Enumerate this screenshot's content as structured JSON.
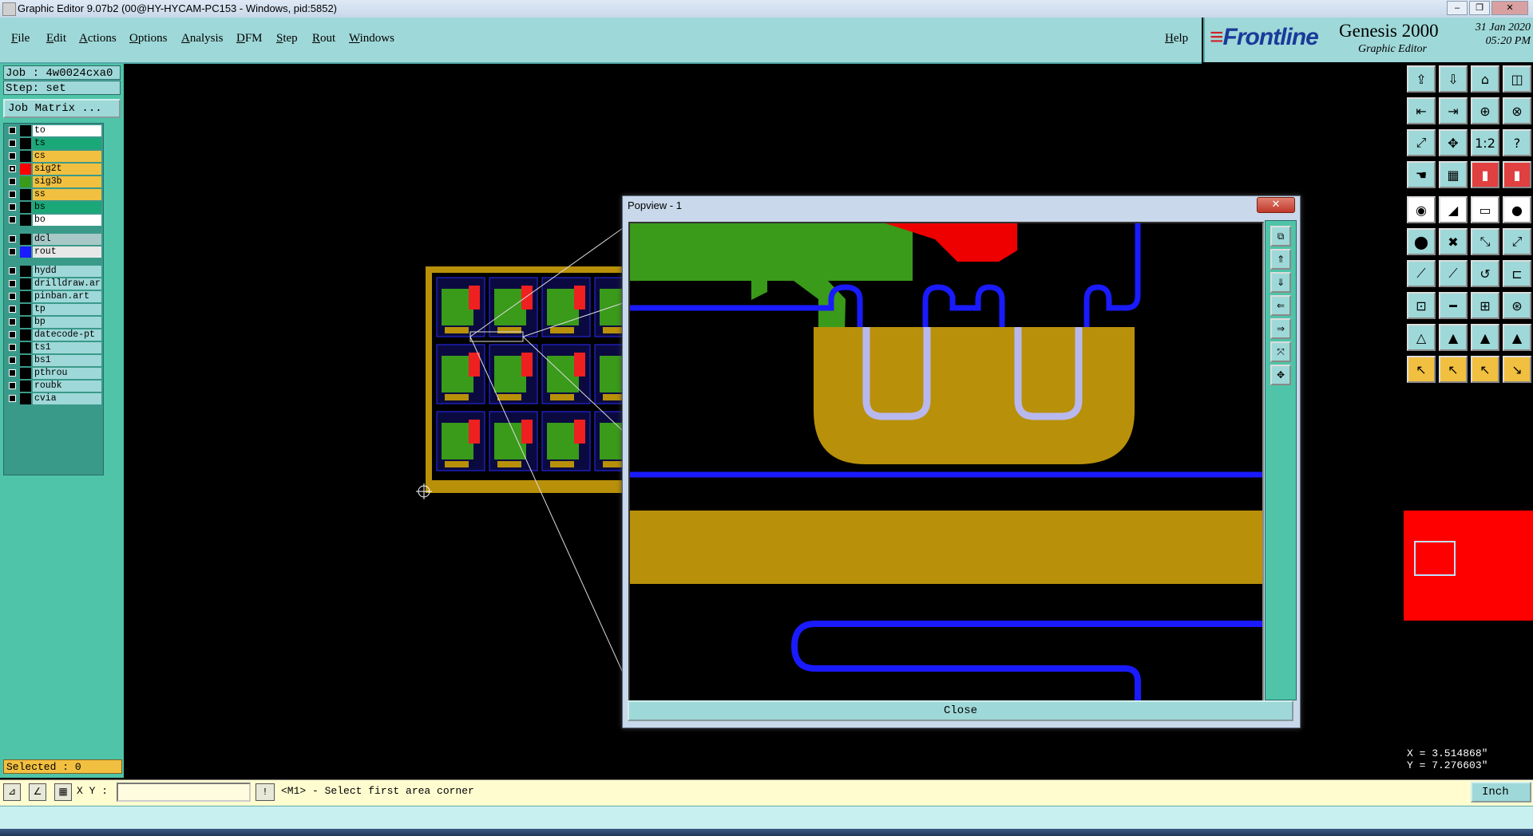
{
  "window": {
    "title": "Graphic Editor 9.07b2 (00@HY-HYCAM-PC153 - Windows, pid:5852)",
    "controls": [
      "‒",
      "❐",
      "✕"
    ]
  },
  "menu": {
    "items": [
      "File",
      "Edit",
      "Actions",
      "Options",
      "Analysis",
      "DFM",
      "Step",
      "Rout",
      "Windows"
    ],
    "help": "Help"
  },
  "brand": {
    "logo": "Frontline",
    "product": "Genesis 2000",
    "subtitle": "Graphic Editor",
    "date": "31 Jan 2020",
    "time": "05:20 PM"
  },
  "left_panel": {
    "job": "Job : 4w0024cxa0",
    "step": "Step: set",
    "job_matrix": "Job Matrix ...",
    "layers": [
      {
        "name": "to",
        "bg": "#ffffff",
        "swatch": "#000000",
        "checked": false
      },
      {
        "name": "ts",
        "bg": "#1aa878",
        "swatch": "#000000",
        "checked": false
      },
      {
        "name": "cs",
        "bg": "#f2c040",
        "swatch": "#000000",
        "checked": false
      },
      {
        "name": "sig2t",
        "bg": "#f2c040",
        "swatch": "#ff0000",
        "checked": true
      },
      {
        "name": "sig3b",
        "bg": "#f2c040",
        "swatch": "#3a9a1a",
        "checked": false
      },
      {
        "name": "ss",
        "bg": "#f2c040",
        "swatch": "#000000",
        "checked": false
      },
      {
        "name": "bs",
        "bg": "#1aa878",
        "swatch": "#000000",
        "checked": false
      },
      {
        "name": "bo",
        "bg": "#ffffff",
        "swatch": "#000000",
        "checked": false
      },
      {
        "name": "dcl",
        "bg": "#a8c8c8",
        "swatch": "#000000",
        "checked": false
      },
      {
        "name": "rout",
        "bg": "#e8e8e8",
        "swatch": "#1a1aff",
        "checked": false
      },
      {
        "name": "hydd",
        "bg": "#9fd8d8",
        "swatch": "#000000",
        "checked": false
      },
      {
        "name": "drilldraw.art",
        "bg": "#9fd8d8",
        "swatch": "#000000",
        "checked": false
      },
      {
        "name": "pinban.art",
        "bg": "#9fd8d8",
        "swatch": "#000000",
        "checked": false
      },
      {
        "name": "tp",
        "bg": "#9fd8d8",
        "swatch": "#000000",
        "checked": false
      },
      {
        "name": "bp",
        "bg": "#9fd8d8",
        "swatch": "#000000",
        "checked": false
      },
      {
        "name": "datecode-pt",
        "bg": "#9fd8d8",
        "swatch": "#000000",
        "checked": false
      },
      {
        "name": "ts1",
        "bg": "#9fd8d8",
        "swatch": "#000000",
        "checked": false
      },
      {
        "name": "bs1",
        "bg": "#9fd8d8",
        "swatch": "#000000",
        "checked": false
      },
      {
        "name": "pthrou",
        "bg": "#9fd8d8",
        "swatch": "#000000",
        "checked": false
      },
      {
        "name": "roubk",
        "bg": "#9fd8d8",
        "swatch": "#000000",
        "checked": false
      },
      {
        "name": "cvia",
        "bg": "#9fd8d8",
        "swatch": "#000000",
        "checked": false
      }
    ],
    "selected": "Selected : 0"
  },
  "popview": {
    "title": "Popview - 1",
    "close_x": "✕",
    "close_label": "Close",
    "side_icons": [
      "popup-layout-icon",
      "page-up-icon",
      "page-down-icon",
      "pan-left-icon",
      "pan-right-icon",
      "zoom-fit-icon",
      "zoom-center-icon"
    ]
  },
  "right_toolbar": {
    "icons": [
      "load-icon",
      "save-icon",
      "home-icon",
      "split-view-icon",
      "import-icon",
      "export-icon",
      "shape-icon",
      "snap-icon",
      "fit-icon",
      "zoom-icon",
      "scale-1-2-icon",
      "help-icon",
      "hand-icon",
      "grid-icon",
      "layer-red-icon",
      "layer-red2-icon",
      "pad-icon",
      "line-icon",
      "ruler-icon",
      "circle-icon",
      "node-icon",
      "cross-icon",
      "connect-icon",
      "route-icon",
      "edit-line-icon",
      "slope-icon",
      "arc-icon",
      "bend-icon",
      "select-node-icon",
      "trim-icon",
      "measure-icon",
      "cluster-icon",
      "triangle-icon",
      "triangle2-icon",
      "triangle3-icon",
      "triangle4-icon",
      "arrow-select-icon",
      "arrow-add-icon",
      "arrow-sub-icon",
      "arrow-route-icon"
    ]
  },
  "coords": {
    "x": "X = 3.514868\"",
    "y": "Y = 7.276603\""
  },
  "statusbar": {
    "xy_label": "X Y :",
    "xy_value": "",
    "message": "<M1> - Select first area corner",
    "units": "Inch"
  }
}
